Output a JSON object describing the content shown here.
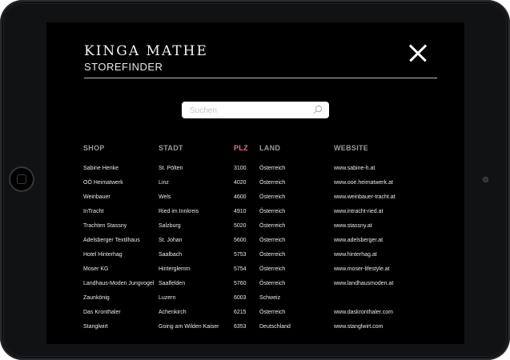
{
  "brand": {
    "name": "KINGA MATHE",
    "subtitle": "STOREFINDER"
  },
  "search": {
    "placeholder": "Suchen",
    "value": ""
  },
  "icons": {
    "close": "close-icon",
    "search": "search-icon"
  },
  "colors": {
    "background": "#000000",
    "text": "#e9e9e9",
    "header": "#9a9a9a",
    "active_header": "#e9718a"
  },
  "table": {
    "columns": [
      "SHOP",
      "STADT",
      "PLZ",
      "LAND",
      "WEBSITE"
    ],
    "active_column": "PLZ",
    "rows": [
      [
        "Sabine Henke",
        "St. Pölten",
        "3100",
        "Österreich",
        "www.sabine-h.at"
      ],
      [
        "OÖ Heimatwerk",
        "Linz",
        "4020",
        "Österreich",
        "www.ooe.heimatwerk.at"
      ],
      [
        "Weinbauer",
        "Wels",
        "4600",
        "Österreich",
        "www.weinbauer-tracht.at"
      ],
      [
        "InTracht",
        "Ried im Innkreis",
        "4910",
        "Österreich",
        "www.intracht-ried.at"
      ],
      [
        "Trachten Stassny",
        "Salzburg",
        "5020",
        "Österreich",
        "www.stassny.at"
      ],
      [
        "Adelsberger Textilhaus",
        "St. Johan",
        "5600",
        "Österreich",
        "www.adelsberger.at"
      ],
      [
        "Hotel Hinterhag",
        "Saalbach",
        "5753",
        "Österreich",
        "www.hinterhag.at"
      ],
      [
        "Moser KG",
        "Hinterglemm",
        "5754",
        "Österreich",
        "www.moser-lifestyle.at"
      ],
      [
        "Landhaus-Moden Jungvogel",
        "Saalfelden",
        "5760",
        "Österreich",
        "www.landhausmoden.at"
      ],
      [
        "Zaunkönig",
        "Luzern",
        "6003",
        "Schweiz",
        ""
      ],
      [
        "Das Kronthaler",
        "Achenkirch",
        "6215",
        "Österreich",
        "www.daskronthaler.com"
      ],
      [
        "Stanglwirt",
        "Going am Wilden Kaiser",
        "6353",
        "Deutschland",
        "www.stanglwirt.com"
      ]
    ]
  }
}
